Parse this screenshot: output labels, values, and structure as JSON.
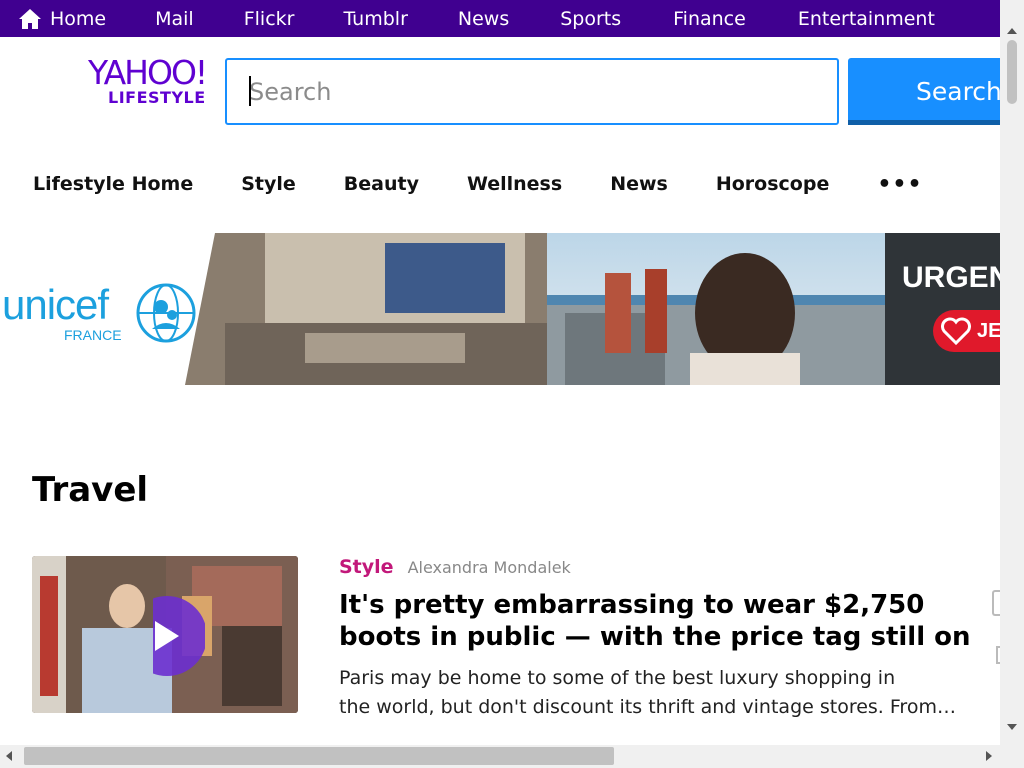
{
  "topnav": {
    "items": [
      {
        "label": "Home",
        "icon": "home-icon"
      },
      {
        "label": "Mail"
      },
      {
        "label": "Flickr"
      },
      {
        "label": "Tumblr"
      },
      {
        "label": "News"
      },
      {
        "label": "Sports"
      },
      {
        "label": "Finance"
      },
      {
        "label": "Entertainment"
      }
    ]
  },
  "header": {
    "logo_top": "YAHOO!",
    "logo_bottom": "LIFESTYLE",
    "search_placeholder": "Search",
    "search_button": "Search"
  },
  "subnav": {
    "items": [
      "Lifestyle Home",
      "Style",
      "Beauty",
      "Wellness",
      "News",
      "Horoscope"
    ],
    "more": "•••"
  },
  "ad": {
    "brand": "unicef",
    "country": "FRANCE",
    "headline": "URGEN",
    "donate": "JE"
  },
  "section": {
    "title": "Travel"
  },
  "article": {
    "category": "Style",
    "author": "Alexandra Mondalek",
    "headline_line1": "It's pretty embarrassing to wear $2,750",
    "headline_line2": "boots in public — with the price tag still on",
    "summary_line1": "Paris may be home to some of the best luxury shopping in",
    "summary_line2": "the world, but don't discount its thrift and vintage stores. From vintage finds",
    "media": "video",
    "play_icon": "play-icon"
  },
  "colors": {
    "topnav_bg": "#400090",
    "brand_purple": "#5f01d1",
    "search_blue": "#188fff",
    "category_pink": "#c2187a",
    "unicef_blue": "#1ca0de"
  }
}
